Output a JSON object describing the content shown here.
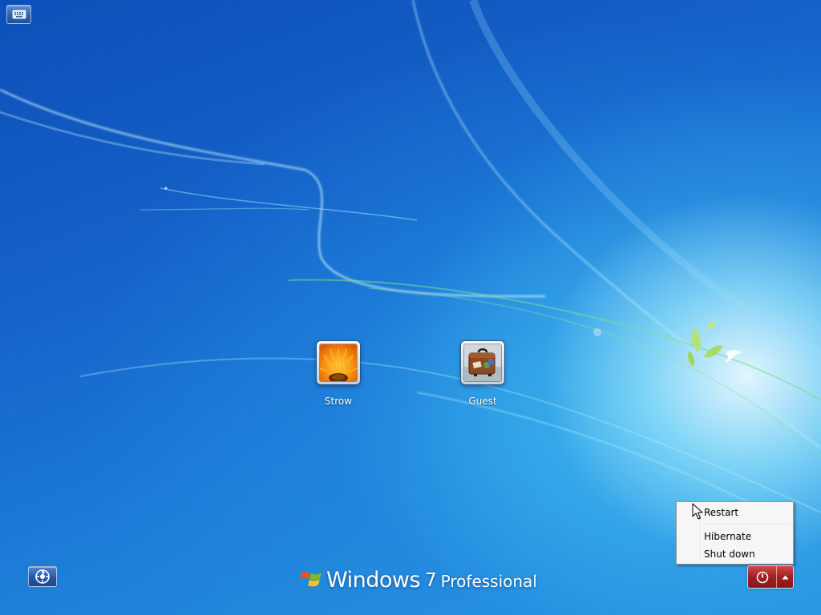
{
  "users": [
    {
      "name": "Strow",
      "picture": "orange-gerbera-flower"
    },
    {
      "name": "Guest",
      "picture": "travel-suitcase"
    }
  ],
  "branding": {
    "windows": "Windows",
    "version": "7",
    "edition": "Professional"
  },
  "power_menu": {
    "items": [
      "Restart",
      "Hibernate",
      "Shut down"
    ]
  },
  "icons": {
    "top_left": "keyboard-icon",
    "bottom_left": "ease-of-access-icon",
    "power": "power-icon",
    "power_arrow": "chevron-up-icon"
  },
  "colors": {
    "power_button": "#a01f22",
    "menu_background": "#f6f6f6"
  }
}
